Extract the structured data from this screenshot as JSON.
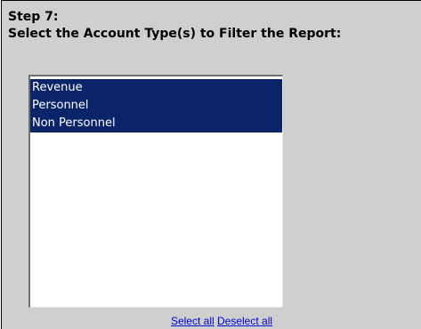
{
  "step": {
    "title": "Step 7:",
    "instruction": "Select the Account Type(s) to Filter the Report:"
  },
  "account_types": {
    "options": [
      {
        "label": "Revenue",
        "selected": true
      },
      {
        "label": "Personnel",
        "selected": true
      },
      {
        "label": "Non Personnel",
        "selected": true
      }
    ]
  },
  "links": {
    "select_all": "Select all",
    "deselect_all": "Deselect all"
  },
  "colors": {
    "panel_background": "#cfcfcf",
    "selected_option_background": "#0a246a",
    "selected_option_text": "#ffffff",
    "link": "#0000cc"
  }
}
